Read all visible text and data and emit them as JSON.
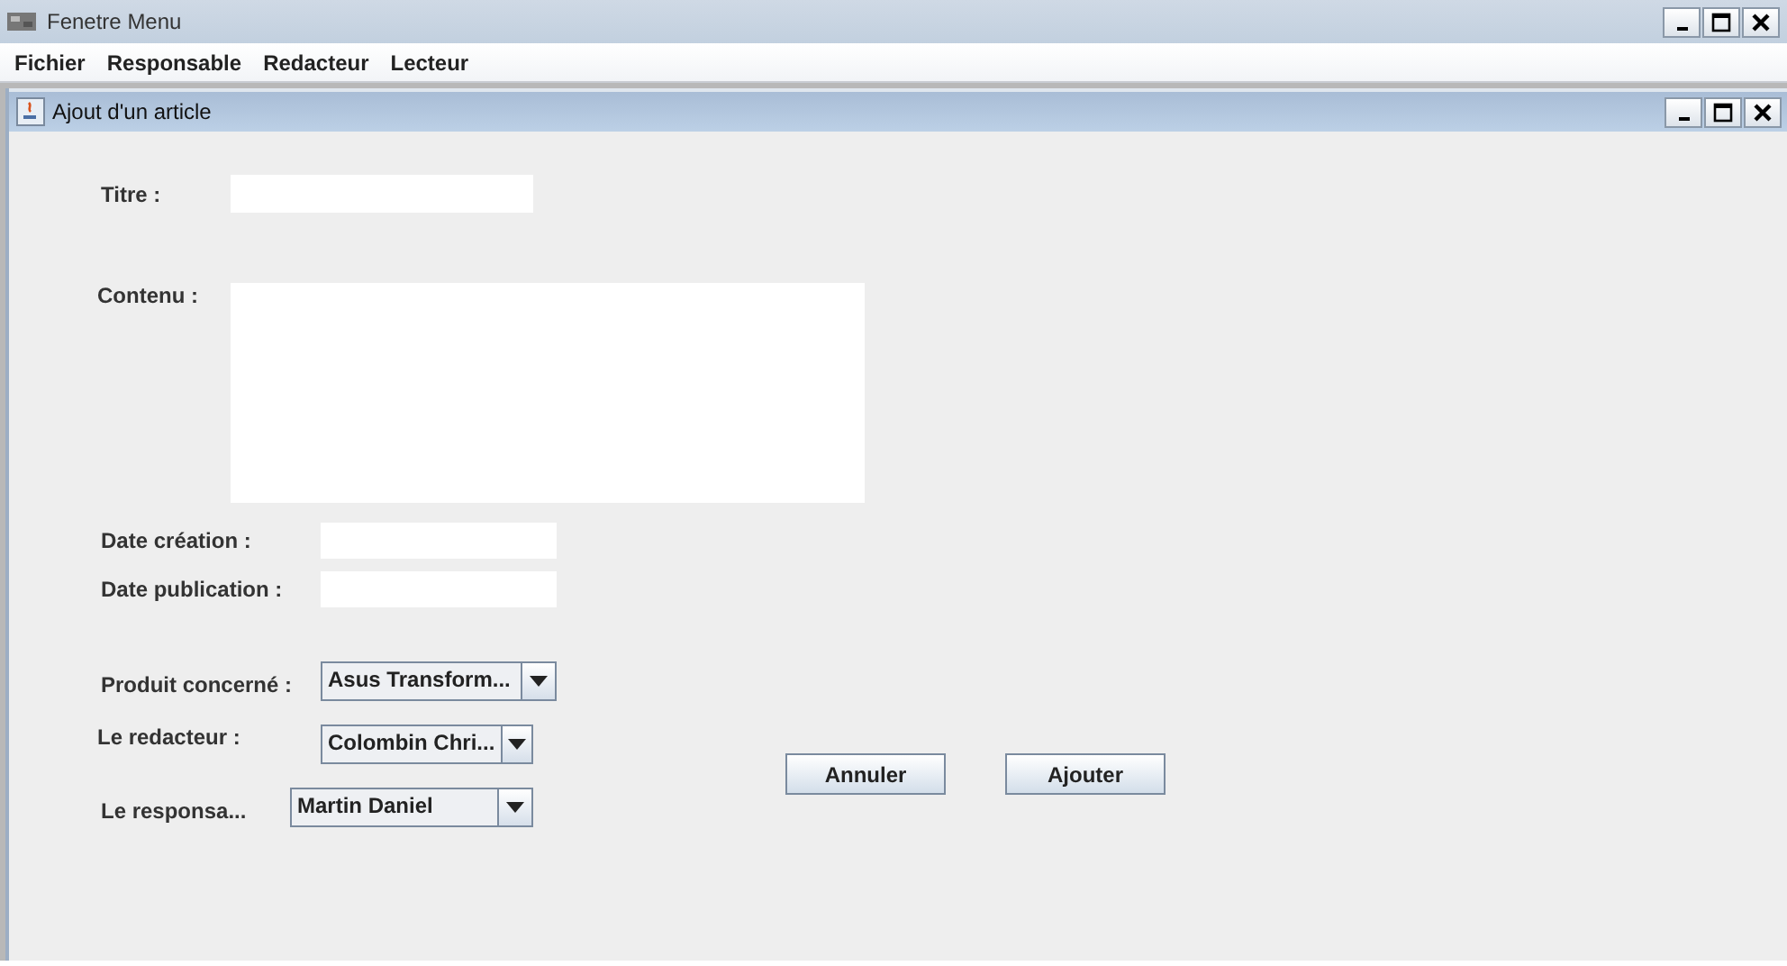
{
  "window": {
    "title": "Fenetre Menu"
  },
  "menu": [
    "Fichier",
    "Responsable",
    "Redacteur",
    "Lecteur"
  ],
  "internal_frame": {
    "title": "Ajout d'un article",
    "fields": [
      {
        "kind": "text",
        "label": "Titre :"
      },
      {
        "kind": "textarea",
        "label": "Contenu :"
      },
      {
        "kind": "date",
        "label": "Date création :"
      },
      {
        "kind": "date",
        "label": "Date publication :"
      }
    ],
    "combos": [
      {
        "kind": "product",
        "label": "Produit concerné :",
        "value": "Asus Transform..."
      },
      {
        "kind": "writer",
        "label": "Le redacteur :",
        "value": "Colombin Chri..."
      },
      {
        "kind": "manager",
        "label": "Le responsa...",
        "value": "Martin Daniel"
      }
    ],
    "buttons": [
      "Annuler",
      "Ajouter"
    ]
  }
}
